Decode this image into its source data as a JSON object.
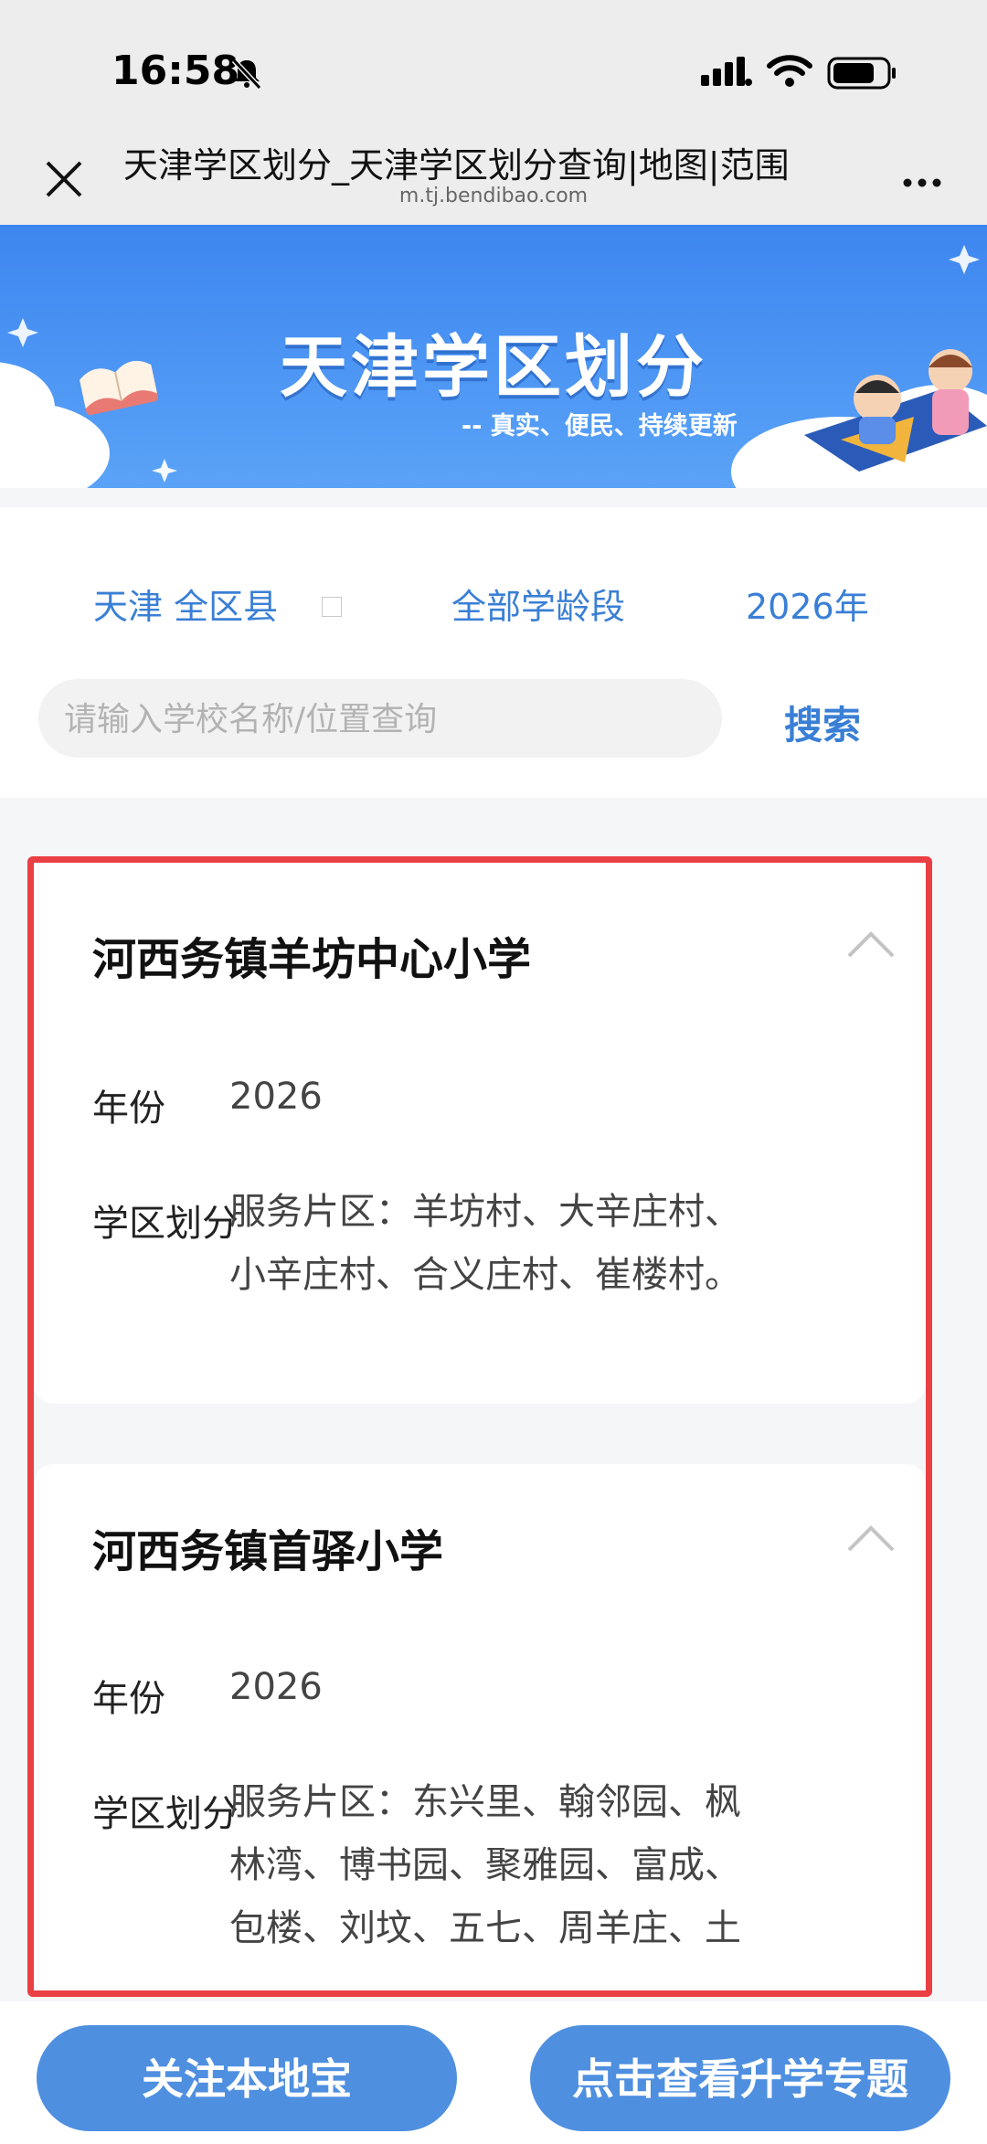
{
  "status_bar": {
    "time": "16:58"
  },
  "navbar": {
    "title": "天津学区划分_天津学区划分查询|地图|范围",
    "url": "m.tj.bendibao.com"
  },
  "banner": {
    "title": "天津学区划分",
    "subtitle": "-- 真实、便民、持续更新"
  },
  "filters": {
    "region": "天津 全区县",
    "stage": "全部学龄段",
    "year": "2026年"
  },
  "search": {
    "placeholder": "请输入学校名称/位置查询",
    "button": "搜索"
  },
  "schools": [
    {
      "name": "河西务镇羊坊中心小学",
      "year_label": "年份",
      "year": "2026",
      "district_label": "学区划分",
      "district_lines": [
        "服务片区：羊坊村、大辛庄村、",
        "小辛庄村、合义庄村、崔楼村。"
      ]
    },
    {
      "name": "河西务镇首驿小学",
      "year_label": "年份",
      "year": "2026",
      "district_label": "学区划分",
      "district_lines": [
        "服务片区：东兴里、翰邻园、枫",
        "林湾、博书园、聚雅园、富成、",
        "包楼、刘坟、五七、周羊庄、土"
      ]
    }
  ],
  "bottom_bar": {
    "follow": "关注本地宝",
    "topic": "点击查看升学专题"
  },
  "colors": {
    "accent": "#3a7fd5",
    "banner": "#4b94f4",
    "highlight_frame": "#ea3f43",
    "bottom_button": "#4f8fe0"
  }
}
